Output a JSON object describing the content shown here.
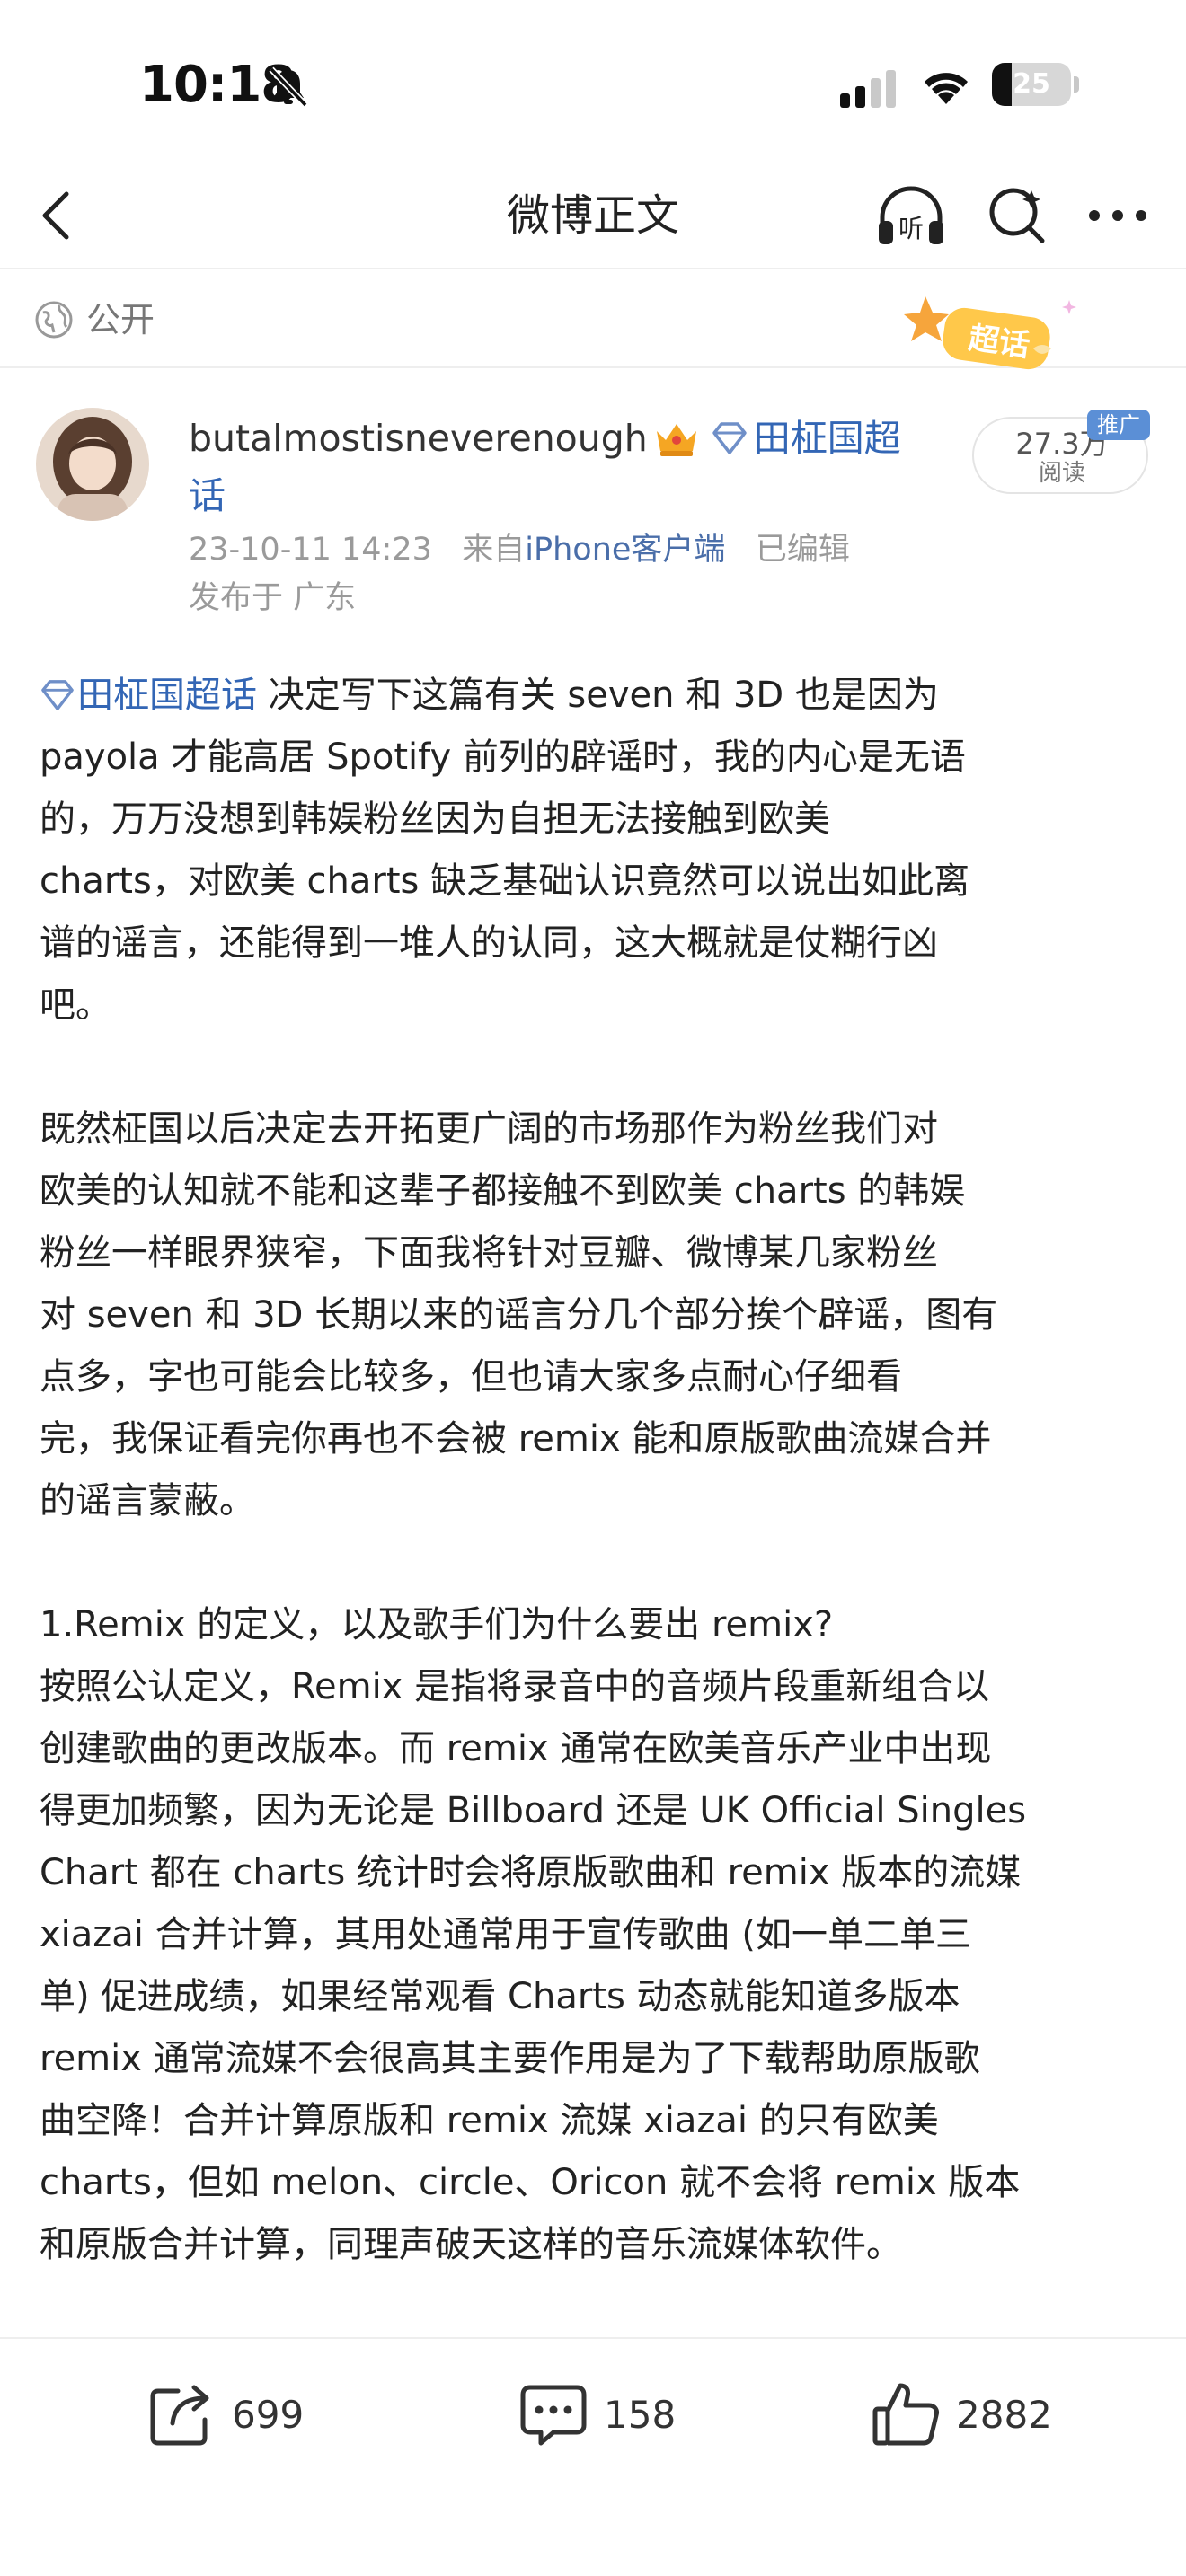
{
  "status_bar": {
    "time": "10:18",
    "battery": "25",
    "battery_level": 0.25
  },
  "nav": {
    "title": "微博正文"
  },
  "visibility": {
    "label": "公开",
    "sticker_text": "超话"
  },
  "author": {
    "name": "butalmostisneverenough",
    "topic_part1": "田柾国超",
    "topic_part2": "话",
    "date": "23-10-11 14:23",
    "source_prefix": "来自",
    "source": "iPhone客户端",
    "edited": "已编辑",
    "location": "发布于 广东"
  },
  "reads": {
    "count": "27.3万",
    "label": "阅读",
    "ad_tag": "推广"
  },
  "post": {
    "topic": "田柾国超话",
    "p1_line1_rest": " 决定写下这篇有关 seven 和 3D 也是因为",
    "p1": [
      "payola 才能高居 Spotify 前列的辟谣时，我的内心是无语",
      "的，万万没想到韩娱粉丝因为自担无法接触到欧美",
      "charts，对欧美 charts 缺乏基础认识竟然可以说出如此离",
      "谱的谣言，还能得到一堆人的认同，这大概就是仗糊行凶",
      "吧。"
    ],
    "p2": [
      "既然柾国以后决定去开拓更广阔的市场那作为粉丝我们对",
      "欧美的认知就不能和这辈子都接触不到欧美 charts 的韩娱",
      "粉丝一样眼界狭窄，下面我将针对豆瓣、微博某几家粉丝",
      "对 seven 和 3D 长期以来的谣言分几个部分挨个辟谣，图有",
      "点多，字也可能会比较多，但也请大家多点耐心仔细看",
      "完，我保证看完你再也不会被 remix 能和原版歌曲流媒合并",
      "的谣言蒙蔽。"
    ],
    "p3": [
      "1.Remix 的定义，以及歌手们为什么要出 remix?",
      "按照公认定义，Remix 是指将录音中的音频片段重新组合以",
      "创建歌曲的更改版本。而 remix 通常在欧美音乐产业中出现",
      "得更加频繁，因为无论是 Billboard 还是 UK Official Singles",
      "Chart 都在 charts 统计时会将原版歌曲和 remix 版本的流媒",
      "xiazai 合并计算，其用处通常用于宣传歌曲 (如一单二单三",
      "单) 促进成绩，如果经常观看 Charts 动态就能知道多版本",
      "remix 通常流媒不会很高其主要作用是为了下载帮助原版歌",
      "曲空降！合并计算原版和 remix 流媒 xiazai 的只有欧美",
      "charts，但如 melon、circle、Oricon 就不会将 remix 版本",
      "和原版合并计算，同理声破天这样的音乐流媒体软件。"
    ]
  },
  "actions": {
    "reposts": "699",
    "comments": "158",
    "likes": "2882"
  },
  "colors": {
    "link_blue": "#3366b5",
    "meta_gray": "#9a9a9a",
    "divider": "#eeeeee"
  }
}
